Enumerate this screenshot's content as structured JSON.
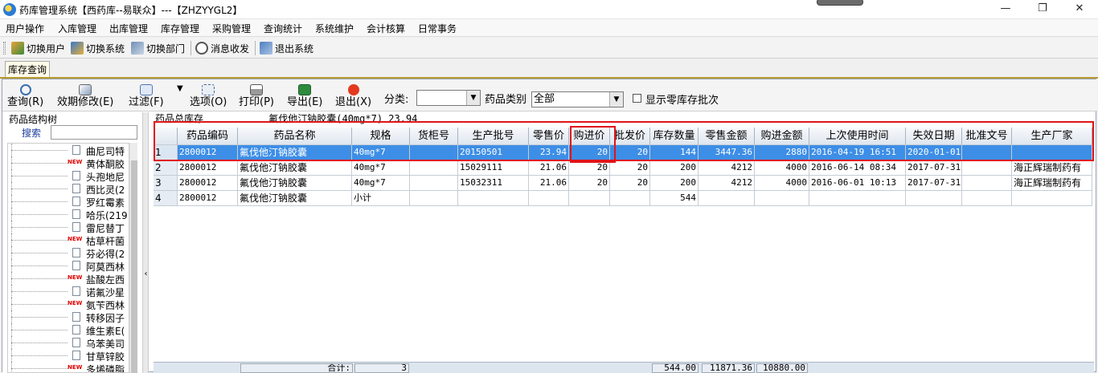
{
  "window": {
    "title": "药库管理系统【西药库--易联众】---【ZHZYYGL2】",
    "minimize": "—",
    "restore": "❐",
    "close": "✕"
  },
  "menu": [
    "用户操作",
    "入库管理",
    "出库管理",
    "库存管理",
    "采购管理",
    "查询统计",
    "系统维护",
    "会计核算",
    "日常事务"
  ],
  "toolbar": {
    "switch_user": "切换用户",
    "switch_system": "切换系统",
    "switch_dept": "切换部门",
    "messages": "消息收发",
    "exit_system": "退出系统"
  },
  "tab": {
    "label": "库存查询"
  },
  "commands": {
    "query": "查询(R)",
    "expiry_edit": "效期修改(E)",
    "filter": "过滤(F)",
    "options": "选项(O)",
    "print": "打印(P)",
    "export": "导出(E)",
    "exit": "退出(X)",
    "category_label": "分类:",
    "category_value": "",
    "drug_type_label": "药品类别",
    "drug_type_value": "全部",
    "show_zero_label": "显示零库存批次"
  },
  "tree": {
    "title": "药品结构树",
    "search_label": "搜索",
    "items": [
      {
        "label": "曲尼司特",
        "new": false
      },
      {
        "label": "黄体酮胶",
        "new": true
      },
      {
        "label": "头孢地尼",
        "new": false
      },
      {
        "label": "西比灵(2",
        "new": false
      },
      {
        "label": "罗红霉素",
        "new": false
      },
      {
        "label": "哈乐(219",
        "new": false
      },
      {
        "label": "雷尼替丁",
        "new": false
      },
      {
        "label": "枯草杆菌",
        "new": true
      },
      {
        "label": "芬必得(2",
        "new": false
      },
      {
        "label": "阿莫西林",
        "new": false
      },
      {
        "label": "盐酸左西",
        "new": true
      },
      {
        "label": "诺氟沙星",
        "new": false
      },
      {
        "label": "氨苄西林",
        "new": true
      },
      {
        "label": "转移因子",
        "new": false
      },
      {
        "label": "维生素E(",
        "new": false
      },
      {
        "label": "乌苯美司",
        "new": false
      },
      {
        "label": "甘草锌胶",
        "new": false
      },
      {
        "label": "多烯磷脂",
        "new": true
      }
    ],
    "new_badge": "NEW"
  },
  "summary": {
    "label": "药品总库存",
    "value": "氟伐他汀钠胶囊(40mg*7) 23.94"
  },
  "grid": {
    "headers": [
      "药品编码",
      "药品名称",
      "规格",
      "货柜号",
      "生产批号",
      "零售价",
      "购进价",
      "批发价",
      "库存数量",
      "零售金额",
      "购进金额",
      "上次使用时间",
      "失效日期",
      "批准文号",
      "生产厂家"
    ],
    "rows": [
      {
        "rn": "1",
        "code": "2800012",
        "name": "氟伐他汀钠胶囊",
        "spec": "40mg*7",
        "cabinet": "",
        "batch": "20150501",
        "retail": "23.94",
        "purchase": "20",
        "wholesale": "20",
        "qty": "144",
        "retail_amt": "3447.36",
        "purchase_amt": "2880",
        "last_used": "2016-04-19 16:51",
        "expiry": "2020-01-01",
        "approval": "",
        "maker": ""
      },
      {
        "rn": "2",
        "code": "2800012",
        "name": "氟伐他汀钠胶囊",
        "spec": "40mg*7",
        "cabinet": "",
        "batch": "15029111",
        "retail": "21.06",
        "purchase": "20",
        "wholesale": "20",
        "qty": "200",
        "retail_amt": "4212",
        "purchase_amt": "4000",
        "last_used": "2016-06-14 08:34",
        "expiry": "2017-07-31",
        "approval": "",
        "maker": "海正辉瑞制药有"
      },
      {
        "rn": "3",
        "code": "2800012",
        "name": "氟伐他汀钠胶囊",
        "spec": "40mg*7",
        "cabinet": "",
        "batch": "15032311",
        "retail": "21.06",
        "purchase": "20",
        "wholesale": "20",
        "qty": "200",
        "retail_amt": "4212",
        "purchase_amt": "4000",
        "last_used": "2016-06-01 10:13",
        "expiry": "2017-07-31",
        "approval": "",
        "maker": "海正辉瑞制药有"
      },
      {
        "rn": "4",
        "code": "2800012",
        "name": "氟伐他汀钠胶囊",
        "spec": "小计",
        "cabinet": "",
        "batch": "",
        "retail": "",
        "purchase": "",
        "wholesale": "",
        "qty": "544",
        "retail_amt": "",
        "purchase_amt": "",
        "last_used": "",
        "expiry": "",
        "approval": "",
        "maker": ""
      }
    ],
    "footer": {
      "total_label": "合计:",
      "count": "3",
      "qty": "544.00",
      "retail_amt": "11871.36",
      "purchase_amt": "10880.00"
    }
  },
  "colors": {
    "selection": "#3d8ee6",
    "highlight_border": "#e0141a",
    "tab_accent": "#b79a2c"
  }
}
